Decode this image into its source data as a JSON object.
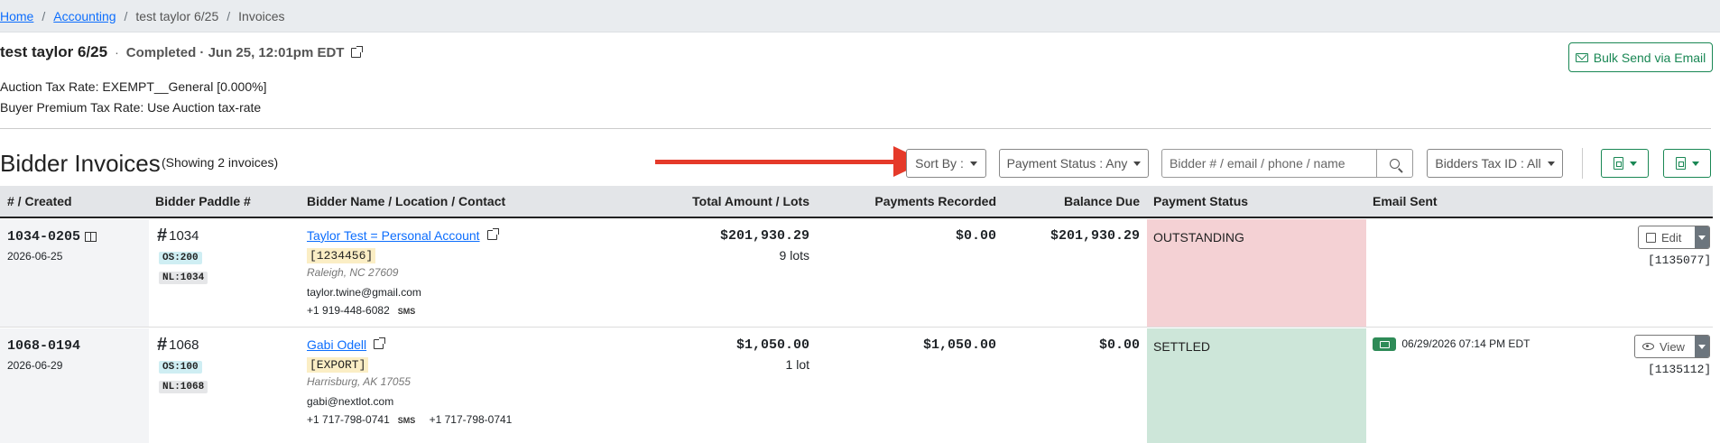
{
  "breadcrumb": {
    "home": "Home",
    "accounting": "Accounting",
    "auction": "test taylor 6/25",
    "current": "Invoices"
  },
  "auction": {
    "name": "test taylor 6/25",
    "status": "Completed · Jun 25, 12:01pm EDT"
  },
  "bulk_send_label": "Bulk Send via Email",
  "tax": {
    "auction_tax_rate": "Auction Tax Rate: EXEMPT__General [0.000%]",
    "buyer_premium_tax_rate": "Buyer Premium Tax Rate: Use Auction tax-rate"
  },
  "section": {
    "title": "Bidder Invoices",
    "showing": "(Showing 2 invoices)"
  },
  "filters": {
    "sort_by": "Sort By :",
    "payment_status": "Payment Status : Any",
    "search_placeholder": "Bidder # / email / phone / name",
    "bidders_tax_id": "Bidders Tax ID : All"
  },
  "columns": [
    "# / Created",
    "Bidder Paddle #",
    "Bidder Name / Location / Contact",
    "Total Amount / Lots",
    "Payments Recorded",
    "Balance Due",
    "Payment Status",
    "Email Sent"
  ],
  "rows": [
    {
      "invoice_no": "1034-0205",
      "created": "2026-06-25",
      "paddle_hash": "#",
      "paddle": "1034",
      "os_badge": "OS:200",
      "nl_badge": "NL:1034",
      "name": "Taylor Test = Personal Account",
      "tag": "[1234456]",
      "location": "Raleigh, NC 27609",
      "email": "taylor.twine@gmail.com",
      "phone": "+1 919-448-6082",
      "sms": "SMS",
      "phone2": "",
      "total": "$201,930.29",
      "lots": "9 lots",
      "payments": "$0.00",
      "balance": "$201,930.29",
      "status": "OUTSTANDING",
      "email_sent": "",
      "action": "Edit",
      "ref": "[1135077]"
    },
    {
      "invoice_no": "1068-0194",
      "created": "2026-06-29",
      "paddle_hash": "#",
      "paddle": "1068",
      "os_badge": "OS:100",
      "nl_badge": "NL:1068",
      "name": "Gabi Odell",
      "tag": "[EXPORT]",
      "location": "Harrisburg, AK 17055",
      "email": "gabi@nextlot.com",
      "phone": "+1 717-798-0741",
      "sms": "SMS",
      "phone2": "+1 717-798-0741",
      "total": "$1,050.00",
      "lots": "1 lot",
      "payments": "$1,050.00",
      "balance": "$0.00",
      "status": "SETTLED",
      "email_sent": "06/29/2026 07:14 PM EDT",
      "action": "View",
      "ref": "[1135112]"
    }
  ],
  "colors": {
    "outstanding": "#f4d1d4",
    "settled": "#cde6d9",
    "green": "#198754",
    "annotation_arrow": "#e53a2a"
  }
}
